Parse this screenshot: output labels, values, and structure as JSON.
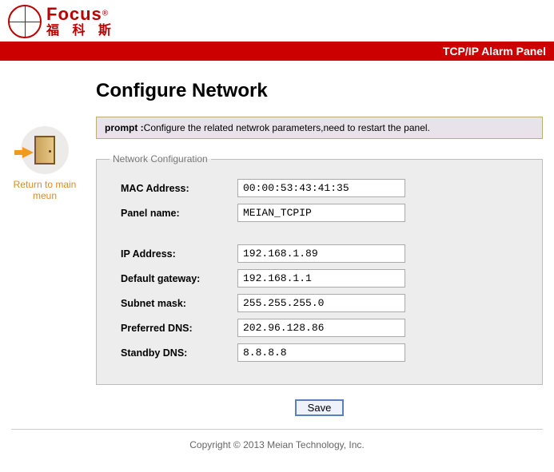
{
  "brand": {
    "en": "Focus",
    "reg": "®",
    "cn": "福 科 斯"
  },
  "redbar_title": "TCP/IP Alarm Panel",
  "side_link": "Return to main meun",
  "page_title": "Configure Network",
  "prompt_label": "prompt :",
  "prompt_text": "Configure the related netwrok parameters,need to restart the panel.",
  "fieldset_legend": "Network Configuration",
  "rows": {
    "mac": {
      "label": "MAC Address:",
      "value": "00:00:53:43:41:35"
    },
    "panel": {
      "label": "Panel name:",
      "value": "MEIAN_TCPIP"
    },
    "ip": {
      "label": "IP Address:",
      "value": "192.168.1.89"
    },
    "gateway": {
      "label": "Default gateway:",
      "value": "192.168.1.1"
    },
    "subnet": {
      "label": "Subnet mask:",
      "value": "255.255.255.0"
    },
    "dns1": {
      "label": "Preferred DNS:",
      "value": "202.96.128.86"
    },
    "dns2": {
      "label": "Standby DNS:",
      "value": "8.8.8.8"
    }
  },
  "save_label": "Save",
  "footer": "Copyright © 2013 Meian Technology, Inc."
}
